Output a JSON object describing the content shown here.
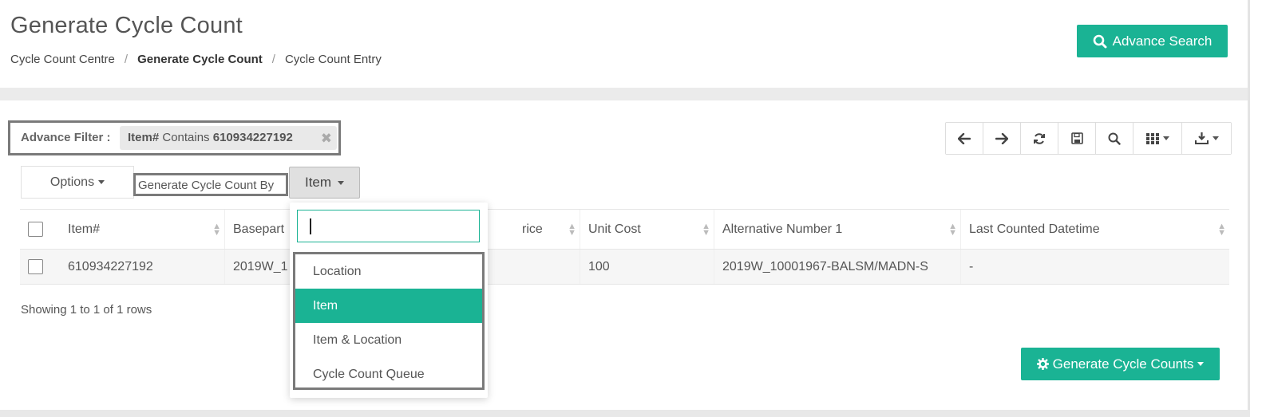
{
  "header": {
    "title": "Generate Cycle Count",
    "breadcrumb": [
      "Cycle Count Centre",
      "Generate Cycle Count",
      "Cycle Count Entry"
    ],
    "advance_search_label": "Advance Search"
  },
  "filter": {
    "label": "Advance Filter :",
    "field": "Item#",
    "operator": "Contains",
    "value": "610934227192"
  },
  "toolbar": {
    "icons": [
      "arrow-left-icon",
      "arrow-right-icon",
      "refresh-icon",
      "save-icon",
      "search-icon",
      "columns-icon",
      "download-icon"
    ]
  },
  "controls": {
    "options_label": "Options",
    "generate_by_label": "Generate Cycle Count By",
    "generate_by_value": "Item"
  },
  "table": {
    "columns": [
      "Item#",
      "Basepart",
      "Price",
      "Unit Cost",
      "Alternative Number 1",
      "Last Counted Datetime"
    ],
    "visible_headers": [
      "Item#",
      "Basepart",
      "rice",
      "Unit Cost",
      "Alternative Number 1",
      "Last Counted Datetime"
    ],
    "rows": [
      [
        "610934227192",
        "2019W_1",
        "",
        "100",
        "2019W_10001967-BALSM/MADN-S",
        "-"
      ]
    ],
    "footer": "Showing 1 to 1 of 1 rows"
  },
  "dropdown": {
    "search_value": "",
    "options": [
      "Location",
      "Item",
      "Item & Location",
      "Cycle Count Queue"
    ],
    "selected": "Item"
  },
  "generate_button_label": "Generate Cycle Counts",
  "colors": {
    "accent": "#1ab394",
    "highlight_border": "#7a7a7a"
  }
}
